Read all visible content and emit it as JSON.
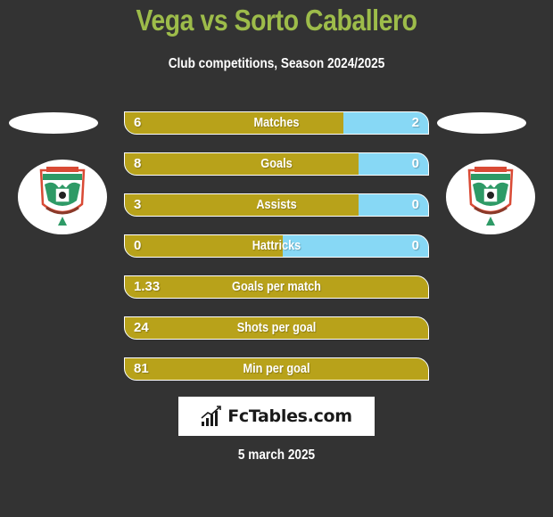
{
  "header": {
    "title": "Vega vs Sorto Caballero",
    "subtitle": "Club competitions, Season 2024/2025"
  },
  "colors": {
    "title": "#9dbc4a",
    "left_bar": "#b8a21a",
    "right_bar": "#87d8f5",
    "background": "#333333"
  },
  "players": {
    "left": {
      "crest_icon": "marathon-club-crest-icon"
    },
    "right": {
      "crest_icon": "marathon-club-crest-icon"
    }
  },
  "stats": [
    {
      "label": "Matches",
      "left": "6",
      "right": "2",
      "left_share": 0.72
    },
    {
      "label": "Goals",
      "left": "8",
      "right": "0",
      "left_share": 0.77
    },
    {
      "label": "Assists",
      "left": "3",
      "right": "0",
      "left_share": 0.77
    },
    {
      "label": "Hattricks",
      "left": "0",
      "right": "0",
      "left_share": 0.52
    },
    {
      "label": "Goals per match",
      "left": "1.33",
      "right": "",
      "left_share": 1.0
    },
    {
      "label": "Shots per goal",
      "left": "24",
      "right": "",
      "left_share": 1.0
    },
    {
      "label": "Min per goal",
      "left": "81",
      "right": "",
      "left_share": 1.0
    }
  ],
  "footer": {
    "logo_text": "FcTables.com",
    "logo_icon": "bar-chart-icon",
    "date": "5 march 2025"
  }
}
